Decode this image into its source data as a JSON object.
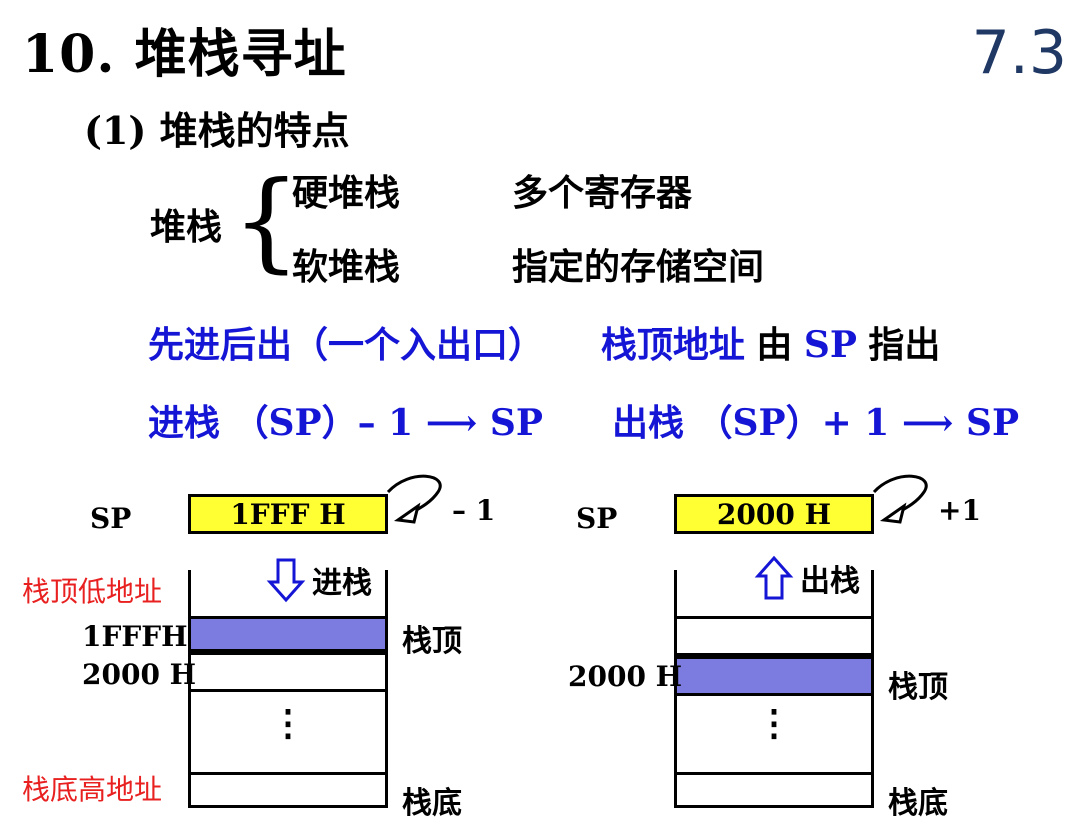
{
  "title": "10. 堆栈寻址",
  "section_number": "7.3",
  "subtitle": "(1) 堆栈的特点",
  "stack_label": "堆栈",
  "kinds": [
    {
      "name": "硬堆栈",
      "desc": "多个寄存器"
    },
    {
      "name": "软堆栈",
      "desc": "指定的存储空间"
    }
  ],
  "line3": {
    "lifo": "先进后出（一个入出口）",
    "top_addr": "栈顶地址",
    "by": "由",
    "sp": "SP",
    "points": "指出"
  },
  "line4": {
    "push": "进栈 （SP）– 1 ⟶ SP",
    "pop": "出栈 （SP）+ 1 ⟶ SP"
  },
  "left_diagram": {
    "sp_label": "SP",
    "register_value": "1FFF H",
    "delta": "– 1",
    "operation": "进栈",
    "top_low_label": "栈顶低地址",
    "bottom_high_label": "栈底高地址",
    "addr1": "1FFFH",
    "addr2": "2000 H",
    "top_label": "栈顶",
    "bottom_label": "栈底",
    "dots": "⋮"
  },
  "right_diagram": {
    "sp_label": "SP",
    "register_value": "2000 H",
    "delta": "+1",
    "operation": "出栈",
    "addr1": "2000 H",
    "top_label": "栈顶",
    "bottom_label": "栈底",
    "dots": "⋮"
  },
  "colors": {
    "blue_text": "#1515d6",
    "register_fill": "#ffff33",
    "stack_top_fill": "#7b7be0",
    "red_text": "#e82020",
    "section_number": "#1f3864"
  }
}
